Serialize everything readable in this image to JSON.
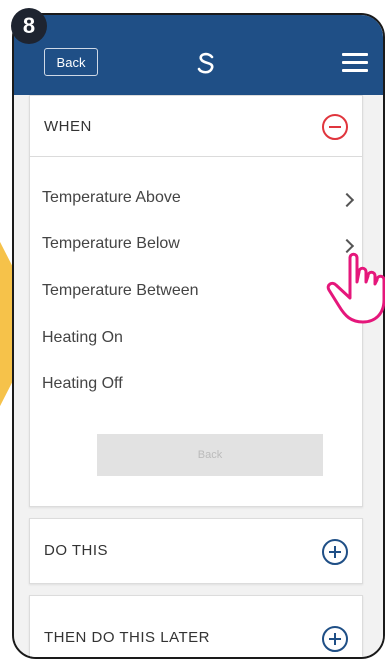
{
  "step_number": "8",
  "header": {
    "back_label": "Back",
    "logo_icon": "s-logo-icon",
    "menu_icon": "hamburger-menu-icon"
  },
  "when_section": {
    "title": "WHEN",
    "options": [
      {
        "label": "Temperature Above",
        "has_chevron": true
      },
      {
        "label": "Temperature Below",
        "has_chevron": true
      },
      {
        "label": "Temperature Between",
        "has_chevron": false
      },
      {
        "label": "Heating On",
        "has_chevron": false
      },
      {
        "label": "Heating Off",
        "has_chevron": false
      }
    ],
    "back_label": "Back"
  },
  "do_section": {
    "title": "DO THIS"
  },
  "later_section": {
    "title": "THEN DO THIS LATER"
  },
  "colors": {
    "header": "#1f4f86",
    "minus": "#e0353d",
    "plus": "#1f4f86",
    "pointer": "#f6c24a",
    "hand": "#e5177b"
  }
}
